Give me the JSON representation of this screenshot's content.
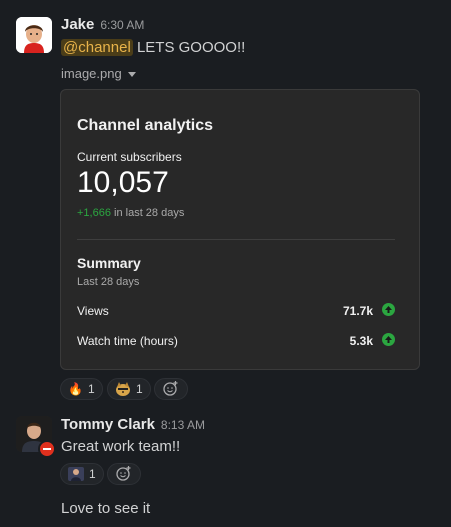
{
  "messages": [
    {
      "author": "Jake",
      "time": "6:30 AM",
      "mention": "@channel",
      "text": "LETS GOOOO!!",
      "attachment_name": "image.png",
      "reactions": [
        {
          "emoji": "🔥",
          "count": "1"
        },
        {
          "emoji": "doge",
          "count": "1"
        }
      ]
    },
    {
      "author": "Tommy Clark",
      "time": "8:13 AM",
      "text": "Great work team!!",
      "reactions": [
        {
          "emoji": "person",
          "count": "1"
        }
      ],
      "followup": "Love to see it"
    }
  ],
  "card": {
    "title": "Channel analytics",
    "subscribers_label": "Current subscribers",
    "subscribers_value": "10,057",
    "delta": "+1,666",
    "delta_suffix": "in last 28 days",
    "summary_title": "Summary",
    "summary_sub": "Last 28 days",
    "rows": [
      {
        "label": "Views",
        "value": "71.7k"
      },
      {
        "label": "Watch time (hours)",
        "value": "5.3k"
      }
    ]
  },
  "colors": {
    "background": "#1a1d21",
    "mention": "#e8b34a",
    "up_green": "#2ba640"
  },
  "icons": {
    "add_reaction": "add-reaction-icon",
    "dropdown": "chevron-down-icon"
  }
}
